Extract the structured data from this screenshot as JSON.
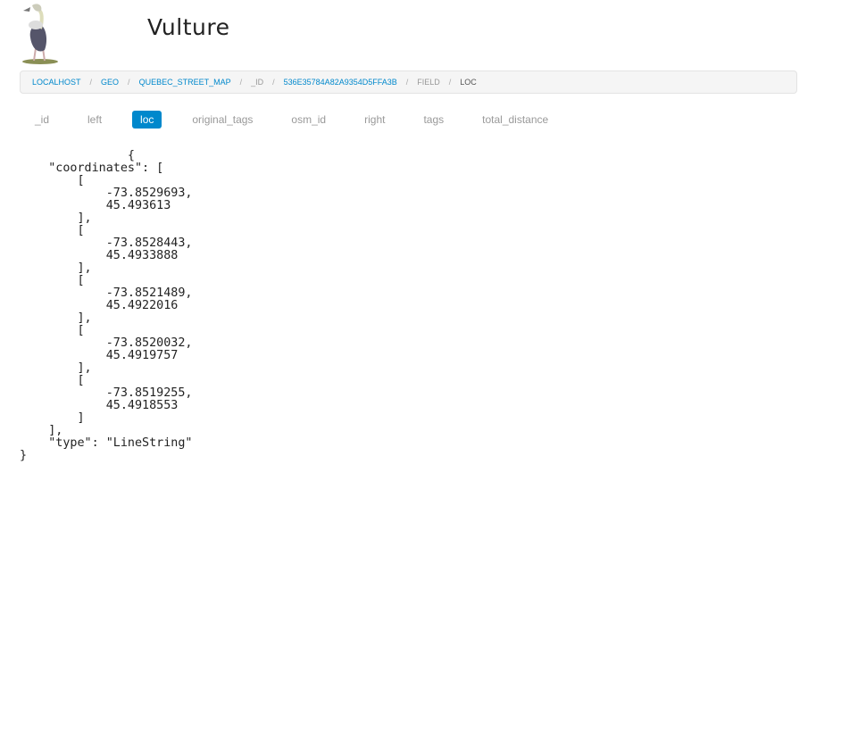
{
  "app": {
    "title": "Vulture",
    "logo_icon": "vulture-logo-icon"
  },
  "breadcrumb": [
    {
      "label": "LOCALHOST",
      "state": "link"
    },
    {
      "label": "GEO",
      "state": "link"
    },
    {
      "label": "QUEBEC_STREET_MAP",
      "state": "link"
    },
    {
      "label": "_ID",
      "state": "muted"
    },
    {
      "label": "536E35784A82A9354D5FFA3B",
      "state": "link"
    },
    {
      "label": "FIELD",
      "state": "muted"
    },
    {
      "label": "LOC",
      "state": "active"
    }
  ],
  "breadcrumb_separator": "/",
  "tabs": [
    {
      "label": "_id",
      "active": false
    },
    {
      "label": "left",
      "active": false
    },
    {
      "label": "loc",
      "active": true
    },
    {
      "label": "original_tags",
      "active": false
    },
    {
      "label": "osm_id",
      "active": false
    },
    {
      "label": "right",
      "active": false
    },
    {
      "label": "tags",
      "active": false
    },
    {
      "label": "total_distance",
      "active": false
    }
  ],
  "document": {
    "text": "               {\n    \"coordinates\": [\n        [\n            -73.8529693,\n            45.493613\n        ],\n        [\n            -73.8528443,\n            45.4933888\n        ],\n        [\n            -73.8521489,\n            45.4922016\n        ],\n        [\n            -73.8520032,\n            45.4919757\n        ],\n        [\n            -73.8519255,\n            45.4918553\n        ]\n    ],\n    \"type\": \"LineString\"\n}"
  },
  "colors": {
    "accent": "#0088cc",
    "link": "#0088cc",
    "muted": "#999999",
    "breadcrumb_bg": "#f5f5f5"
  }
}
